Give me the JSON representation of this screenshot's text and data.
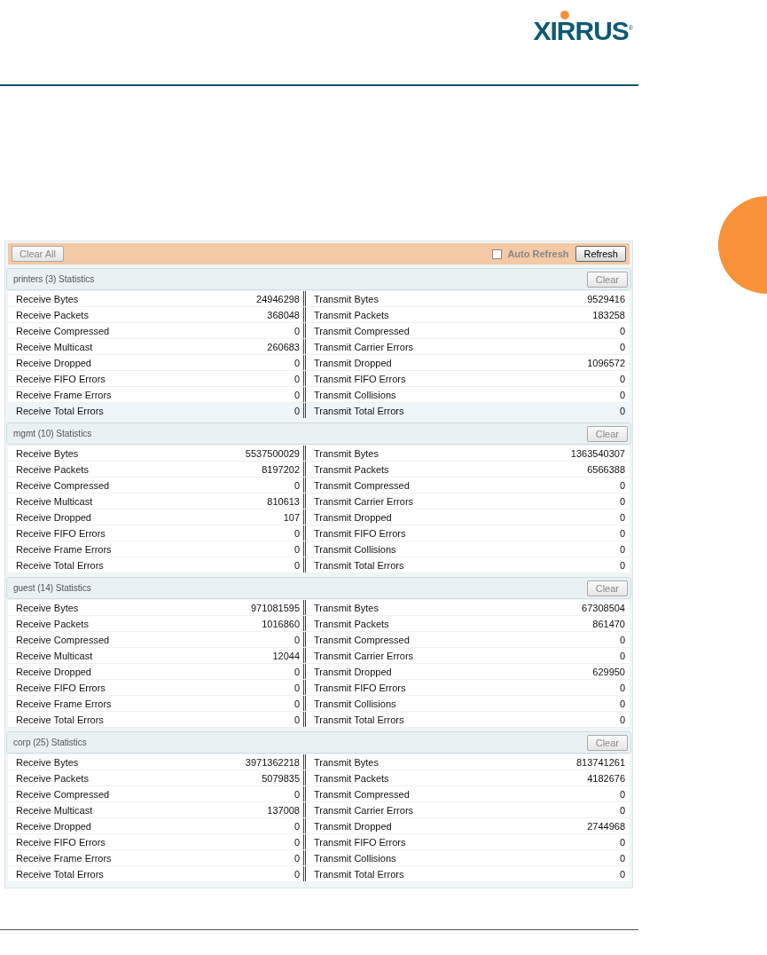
{
  "logo": {
    "text": "XIRRUS",
    "mark": "®"
  },
  "toolbar": {
    "clear_all": "Clear All",
    "auto_refresh": {
      "label": "Auto Refresh",
      "checked": false
    },
    "refresh": "Refresh"
  },
  "sections": [
    {
      "title": "printers (3) Statistics",
      "clear": "Clear",
      "rows": [
        {
          "receive_label": "Receive Bytes",
          "receive_value": "24946298",
          "transmit_label": "Transmit Bytes",
          "transmit_value": "9529416",
          "highlighted": false
        },
        {
          "receive_label": "Receive Packets",
          "receive_value": "368048",
          "transmit_label": "Transmit Packets",
          "transmit_value": "183258",
          "highlighted": false
        },
        {
          "receive_label": "Receive Compressed",
          "receive_value": "0",
          "transmit_label": "Transmit Compressed",
          "transmit_value": "0",
          "highlighted": false
        },
        {
          "receive_label": "Receive Multicast",
          "receive_value": "260683",
          "transmit_label": "Transmit Carrier Errors",
          "transmit_value": "0",
          "highlighted": false
        },
        {
          "receive_label": "Receive Dropped",
          "receive_value": "0",
          "transmit_label": "Transmit Dropped",
          "transmit_value": "1096572",
          "highlighted": false
        },
        {
          "receive_label": "Receive FIFO Errors",
          "receive_value": "0",
          "transmit_label": "Transmit FIFO Errors",
          "transmit_value": "0",
          "highlighted": false
        },
        {
          "receive_label": "Receive Frame Errors",
          "receive_value": "0",
          "transmit_label": "Transmit Collisions",
          "transmit_value": "0",
          "highlighted": false
        },
        {
          "receive_label": "Receive Total Errors",
          "receive_value": "0",
          "transmit_label": "Transmit Total Errors",
          "transmit_value": "0",
          "highlighted": true
        }
      ]
    },
    {
      "title": "mgmt (10) Statistics",
      "clear": "Clear",
      "rows": [
        {
          "receive_label": "Receive Bytes",
          "receive_value": "5537500029",
          "transmit_label": "Transmit Bytes",
          "transmit_value": "1363540307",
          "highlighted": false
        },
        {
          "receive_label": "Receive Packets",
          "receive_value": "8197202",
          "transmit_label": "Transmit Packets",
          "transmit_value": "6566388",
          "highlighted": false
        },
        {
          "receive_label": "Receive Compressed",
          "receive_value": "0",
          "transmit_label": "Transmit Compressed",
          "transmit_value": "0",
          "highlighted": false
        },
        {
          "receive_label": "Receive Multicast",
          "receive_value": "810613",
          "transmit_label": "Transmit Carrier Errors",
          "transmit_value": "0",
          "highlighted": false
        },
        {
          "receive_label": "Receive Dropped",
          "receive_value": "107",
          "transmit_label": "Transmit Dropped",
          "transmit_value": "0",
          "highlighted": false
        },
        {
          "receive_label": "Receive FIFO Errors",
          "receive_value": "0",
          "transmit_label": "Transmit FIFO Errors",
          "transmit_value": "0",
          "highlighted": false
        },
        {
          "receive_label": "Receive Frame Errors",
          "receive_value": "0",
          "transmit_label": "Transmit Collisions",
          "transmit_value": "0",
          "highlighted": false
        },
        {
          "receive_label": "Receive Total Errors",
          "receive_value": "0",
          "transmit_label": "Transmit Total Errors",
          "transmit_value": "0",
          "highlighted": false
        }
      ]
    },
    {
      "title": "guest (14) Statistics",
      "clear": "Clear",
      "rows": [
        {
          "receive_label": "Receive Bytes",
          "receive_value": "971081595",
          "transmit_label": "Transmit Bytes",
          "transmit_value": "67308504",
          "highlighted": false
        },
        {
          "receive_label": "Receive Packets",
          "receive_value": "1016860",
          "transmit_label": "Transmit Packets",
          "transmit_value": "861470",
          "highlighted": false
        },
        {
          "receive_label": "Receive Compressed",
          "receive_value": "0",
          "transmit_label": "Transmit Compressed",
          "transmit_value": "0",
          "highlighted": false
        },
        {
          "receive_label": "Receive Multicast",
          "receive_value": "12044",
          "transmit_label": "Transmit Carrier Errors",
          "transmit_value": "0",
          "highlighted": false
        },
        {
          "receive_label": "Receive Dropped",
          "receive_value": "0",
          "transmit_label": "Transmit Dropped",
          "transmit_value": "629950",
          "highlighted": false
        },
        {
          "receive_label": "Receive FIFO Errors",
          "receive_value": "0",
          "transmit_label": "Transmit FIFO Errors",
          "transmit_value": "0",
          "highlighted": false
        },
        {
          "receive_label": "Receive Frame Errors",
          "receive_value": "0",
          "transmit_label": "Transmit Collisions",
          "transmit_value": "0",
          "highlighted": false
        },
        {
          "receive_label": "Receive Total Errors",
          "receive_value": "0",
          "transmit_label": "Transmit Total Errors",
          "transmit_value": "0",
          "highlighted": false
        }
      ]
    },
    {
      "title": "corp (25) Statistics",
      "clear": "Clear",
      "rows": [
        {
          "receive_label": "Receive Bytes",
          "receive_value": "3971362218",
          "transmit_label": "Transmit Bytes",
          "transmit_value": "813741261",
          "highlighted": false
        },
        {
          "receive_label": "Receive Packets",
          "receive_value": "5079835",
          "transmit_label": "Transmit Packets",
          "transmit_value": "4182676",
          "highlighted": false
        },
        {
          "receive_label": "Receive Compressed",
          "receive_value": "0",
          "transmit_label": "Transmit Compressed",
          "transmit_value": "0",
          "highlighted": false
        },
        {
          "receive_label": "Receive Multicast",
          "receive_value": "137008",
          "transmit_label": "Transmit Carrier Errors",
          "transmit_value": "0",
          "highlighted": false
        },
        {
          "receive_label": "Receive Dropped",
          "receive_value": "0",
          "transmit_label": "Transmit Dropped",
          "transmit_value": "2744968",
          "highlighted": false
        },
        {
          "receive_label": "Receive FIFO Errors",
          "receive_value": "0",
          "transmit_label": "Transmit FIFO Errors",
          "transmit_value": "0",
          "highlighted": false
        },
        {
          "receive_label": "Receive Frame Errors",
          "receive_value": "0",
          "transmit_label": "Transmit Collisions",
          "transmit_value": "0",
          "highlighted": false
        },
        {
          "receive_label": "Receive Total Errors",
          "receive_value": "0",
          "transmit_label": "Transmit Total Errors",
          "transmit_value": "0",
          "highlighted": false
        }
      ]
    }
  ]
}
